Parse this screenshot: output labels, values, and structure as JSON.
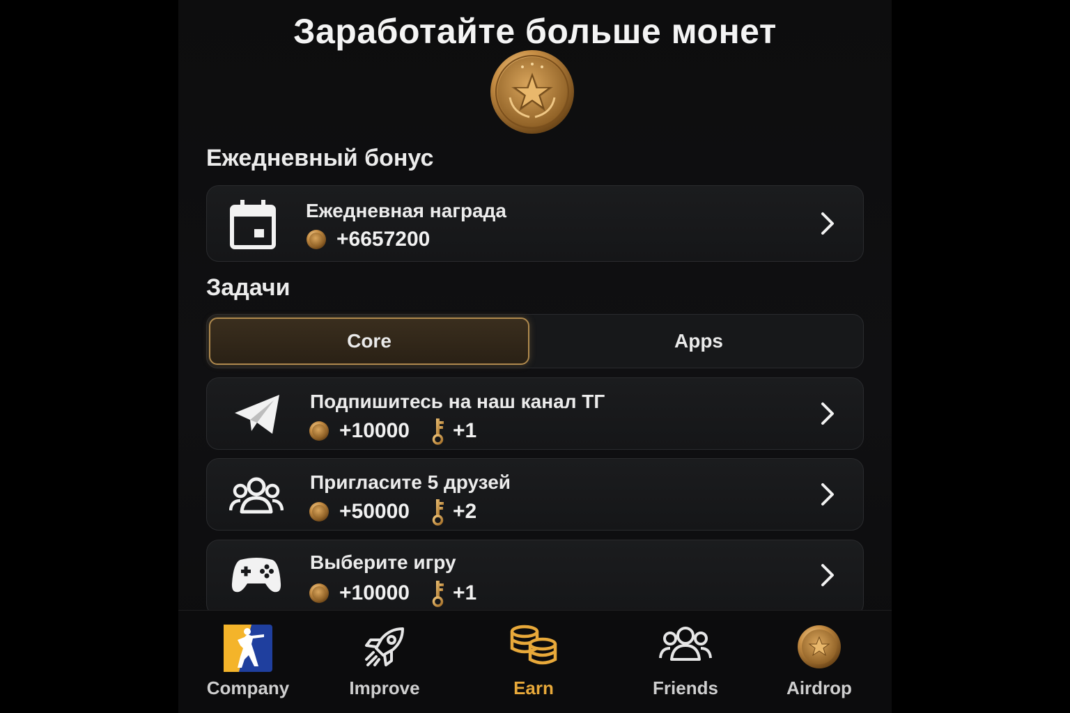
{
  "header": {
    "title": "Заработайте больше монет"
  },
  "daily": {
    "section_title": "Ежедневный бонус",
    "card": {
      "name": "Ежедневная награда",
      "coins": "+6657200",
      "icon": "calendar-icon"
    }
  },
  "tasks": {
    "section_title": "Задачи",
    "tabs": [
      {
        "label": "Core",
        "active": true
      },
      {
        "label": "Apps",
        "active": false
      }
    ],
    "items": [
      {
        "name": "Подпишитесь на наш канал ТГ",
        "coins": "+10000",
        "keys": "+1",
        "icon": "telegram-icon"
      },
      {
        "name": "Пригласите 5 друзей",
        "coins": "+50000",
        "keys": "+2",
        "icon": "users-icon"
      },
      {
        "name": "Выберите игру",
        "coins": "+10000",
        "keys": "+1",
        "icon": "gamepad-icon"
      }
    ]
  },
  "nav": {
    "items": [
      {
        "label": "Company",
        "icon": "company-logo-icon"
      },
      {
        "label": "Improve",
        "icon": "rocket-icon"
      },
      {
        "label": "Earn",
        "icon": "coins-stack-icon",
        "active": true
      },
      {
        "label": "Friends",
        "icon": "friends-icon"
      },
      {
        "label": "Airdrop",
        "icon": "coin-icon"
      }
    ]
  },
  "colors": {
    "accent": "#e8a93a",
    "gold": "#c9923f",
    "background": "#0e0e10",
    "card": "#1a1b1d"
  }
}
